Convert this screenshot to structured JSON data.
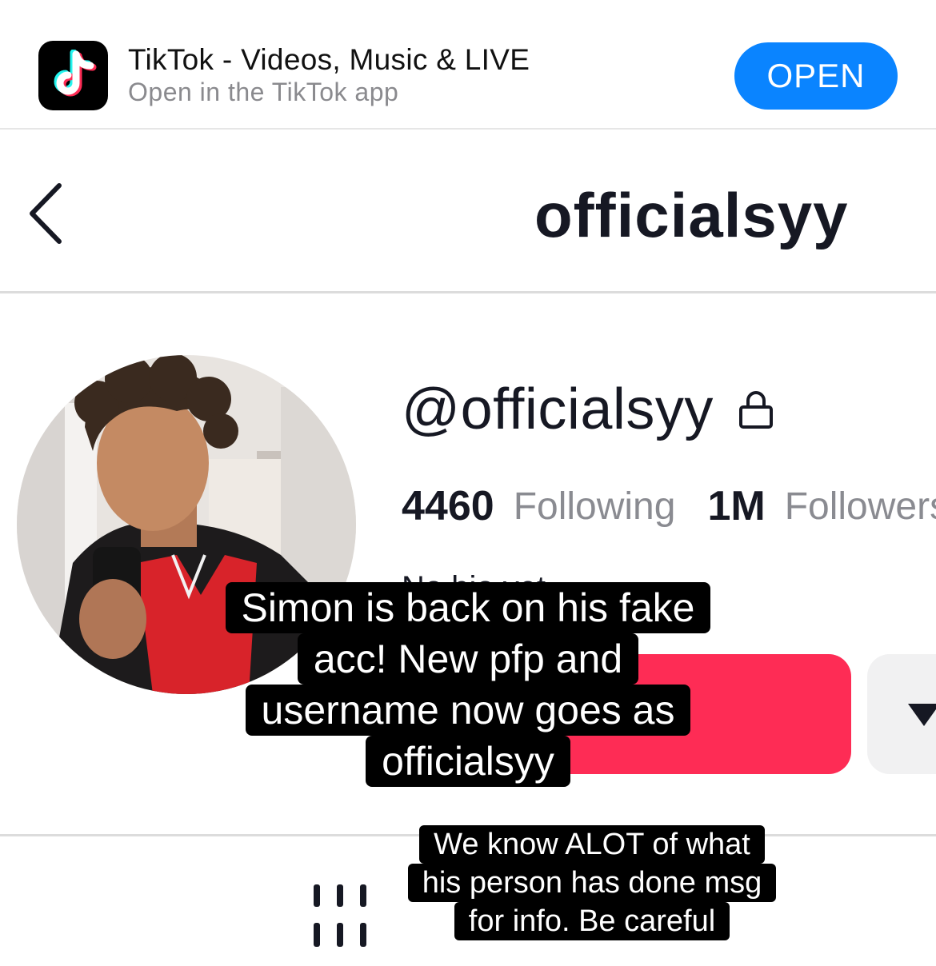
{
  "app_banner": {
    "title": "TikTok - Videos, Music & LIVE",
    "subtitle": "Open in the TikTok app",
    "open_label": "OPEN",
    "icon": "tiktok-logo-icon"
  },
  "navbar": {
    "back_icon": "chevron-left-icon",
    "title": "officialsyy"
  },
  "profile": {
    "handle": "@officialsyy",
    "private_icon": "lock-icon",
    "following_count": "4460",
    "following_label": "Following",
    "followers_count": "1M",
    "followers_label": "Followers",
    "bio_peek": "No bio yet"
  },
  "captions": {
    "main": [
      "Simon is back on his fake",
      "acc! New pfp and",
      "username now goes as",
      "officialsyy"
    ],
    "secondary": [
      "We know ALOT of what",
      "his person has done msg",
      "for info. Be careful"
    ]
  },
  "colors": {
    "accent_blue": "#0a84ff",
    "follow_red": "#fe2c55",
    "text_dark": "#161823",
    "text_gray": "#8a8b91"
  }
}
